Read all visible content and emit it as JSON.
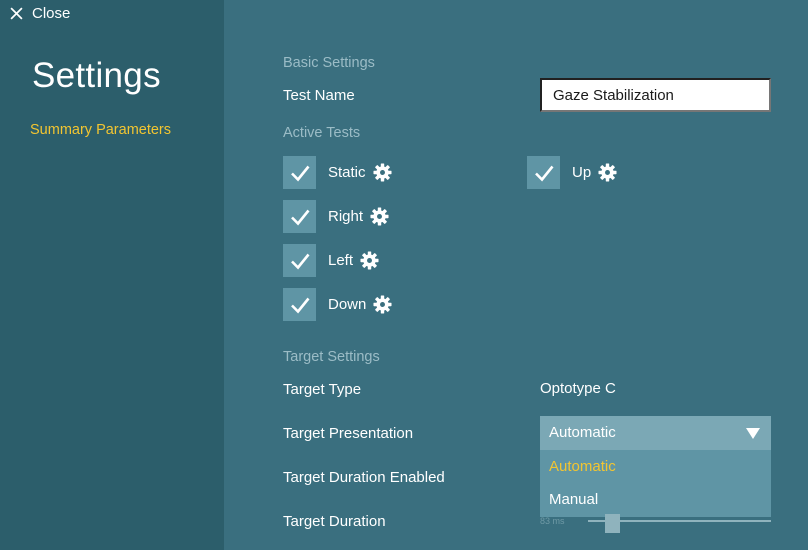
{
  "sidebar": {
    "close_label": "Close",
    "title": "Settings",
    "nav_items": [
      {
        "label": "Summary Parameters"
      }
    ]
  },
  "basic_settings": {
    "heading": "Basic Settings",
    "test_name_label": "Test Name",
    "test_name_value": "Gaze Stabilization"
  },
  "active_tests": {
    "heading": "Active Tests",
    "items": [
      {
        "label": "Static",
        "checked": true
      },
      {
        "label": "Right",
        "checked": true
      },
      {
        "label": "Left",
        "checked": true
      },
      {
        "label": "Down",
        "checked": true
      },
      {
        "label": "Up",
        "checked": true
      }
    ]
  },
  "target_settings": {
    "heading": "Target Settings",
    "target_type_label": "Target Type",
    "target_type_value": "Optotype C",
    "target_presentation_label": "Target Presentation",
    "target_presentation_value": "Automatic",
    "target_presentation_options": [
      "Automatic",
      "Manual"
    ],
    "target_duration_enabled_label": "Target Duration Enabled",
    "target_duration_label": "Target Duration",
    "target_duration_value": "83 ms"
  },
  "colors": {
    "sidebar_bg": "#2c5e6b",
    "main_bg": "#3a6f7f",
    "accent": "#f2c531",
    "checkbox_bg": "#5f95a5"
  }
}
